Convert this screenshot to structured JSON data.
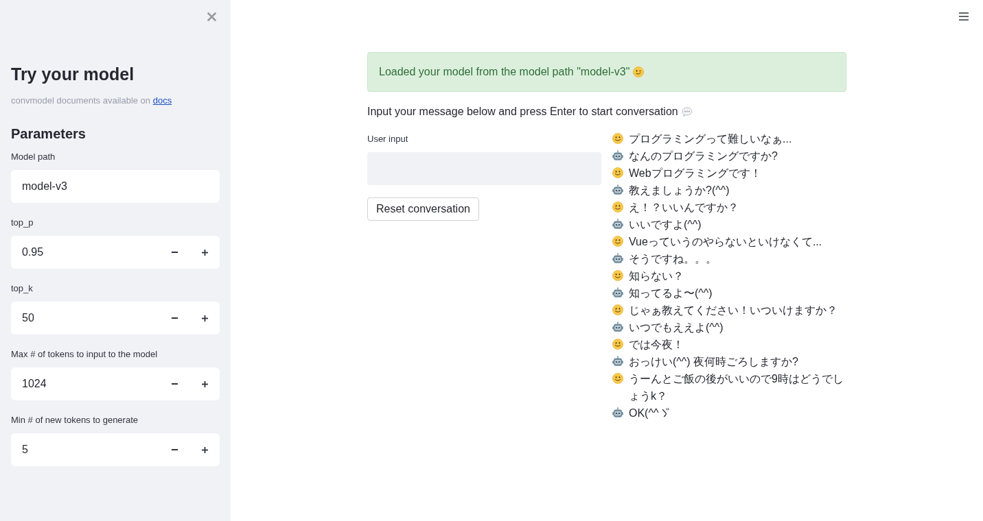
{
  "sidebar": {
    "title": "Try your model",
    "caption": {
      "text": "convmodel documents available on",
      "link": "docs"
    },
    "section_title": "Parameters",
    "fields": [
      {
        "kind": "text",
        "label": "Model path",
        "value": "model-v3"
      },
      {
        "kind": "number",
        "label": "top_p",
        "value": "0.95"
      },
      {
        "kind": "number",
        "label": "top_k",
        "value": "50"
      },
      {
        "kind": "number",
        "label": "Max # of tokens to input to the model",
        "value": "1024"
      },
      {
        "kind": "number",
        "label": "Min # of new tokens to generate",
        "value": "5"
      }
    ]
  },
  "main": {
    "alert": {
      "text": "Loaded your model from the model path \"model-v3\""
    },
    "instruction": "Input your message below and press Enter to start conversation",
    "user_input": {
      "label": "User input"
    },
    "reset_button": "Reset conversation",
    "messages": [
      {
        "kind": "user",
        "text": "プログラミングって難しいなぁ..."
      },
      {
        "kind": "bot",
        "text": "なんのプログラミングですか?"
      },
      {
        "kind": "user",
        "text": "Webプログラミングです！"
      },
      {
        "kind": "bot",
        "text": "教えましょうか?(^^)"
      },
      {
        "kind": "user",
        "text": "え！？いいんですか？"
      },
      {
        "kind": "bot",
        "text": "いいですよ(^^)"
      },
      {
        "kind": "user",
        "text": "Vueっていうのやらないといけなくて..."
      },
      {
        "kind": "bot",
        "text": "そうですね。。。"
      },
      {
        "kind": "user",
        "text": "知らない？"
      },
      {
        "kind": "bot",
        "text": "知ってるよ〜(^^)"
      },
      {
        "kind": "user",
        "text": "じゃぁ教えてください！いついけますか？"
      },
      {
        "kind": "bot",
        "text": "いつでもええよ(^^)"
      },
      {
        "kind": "user",
        "text": "では今夜！"
      },
      {
        "kind": "bot",
        "text": "おっけい(^^) 夜何時ごろしますか?"
      },
      {
        "kind": "user",
        "text": "うーんとご飯の後がいいので9時はどうでしょうk？"
      },
      {
        "kind": "bot",
        "text": "OK(^^",
        "trailing_mark": true
      }
    ]
  }
}
